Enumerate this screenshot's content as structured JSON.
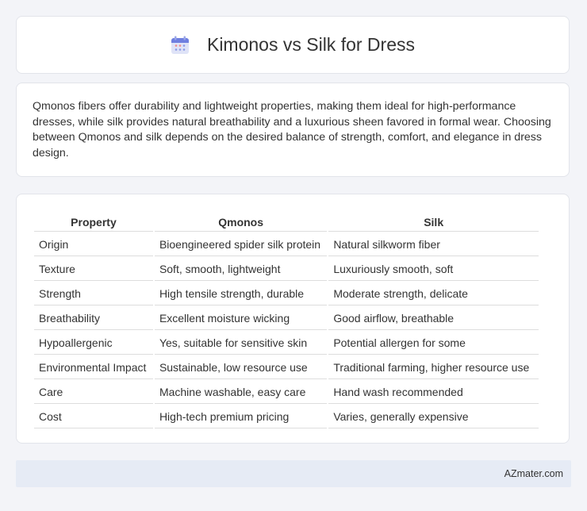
{
  "header": {
    "title": "Kimonos vs Silk for Dress",
    "icon": "calendar-icon"
  },
  "intro": {
    "text": "Qmonos fibers offer durability and lightweight properties, making them ideal for high-performance dresses, while silk provides natural breathability and a luxurious sheen favored in formal wear. Choosing between Qmonos and silk depends on the desired balance of strength, comfort, and elegance in dress design."
  },
  "table": {
    "headers": [
      "Property",
      "Qmonos",
      "Silk"
    ],
    "rows": [
      [
        "Origin",
        "Bioengineered spider silk protein",
        "Natural silkworm fiber"
      ],
      [
        "Texture",
        "Soft, smooth, lightweight",
        "Luxuriously smooth, soft"
      ],
      [
        "Strength",
        "High tensile strength, durable",
        "Moderate strength, delicate"
      ],
      [
        "Breathability",
        "Excellent moisture wicking",
        "Good airflow, breathable"
      ],
      [
        "Hypoallergenic",
        "Yes, suitable for sensitive skin",
        "Potential allergen for some"
      ],
      [
        "Environmental Impact",
        "Sustainable, low resource use",
        "Traditional farming, higher resource use"
      ],
      [
        "Care",
        "Machine washable, easy care",
        "Hand wash recommended"
      ],
      [
        "Cost",
        "High-tech premium pricing",
        "Varies, generally expensive"
      ]
    ]
  },
  "footer": {
    "text": "AZmater.com"
  }
}
